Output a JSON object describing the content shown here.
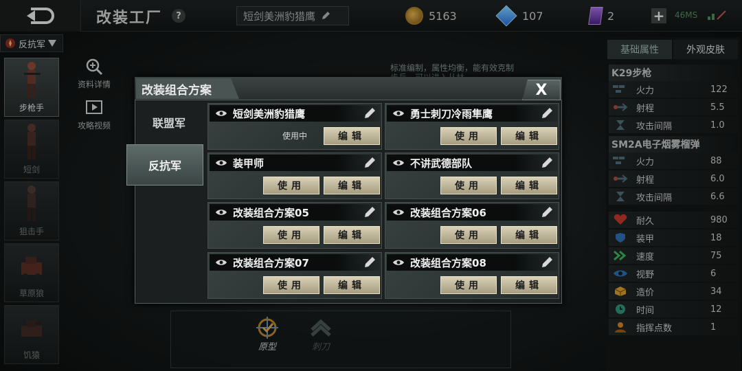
{
  "topbar": {
    "title": "改装工厂",
    "help": "?",
    "loadout_name": "短剑美洲豹猎鹰",
    "gold": "5163",
    "diamonds": "107",
    "cards": "2",
    "ping": "46MS"
  },
  "left": {
    "faction": "反抗军",
    "units": [
      "步枪手",
      "短剑",
      "狙击手",
      "草原狼",
      "饥猿"
    ],
    "tools": [
      "资料详情",
      "攻略视频"
    ]
  },
  "background_note": "标准编制，属性均衡，能有效克制步兵，可以进入丛林",
  "bottom": {
    "prototype": "原型",
    "dagger": "刺刀"
  },
  "right": {
    "tabs": [
      "基础属性",
      "外观皮肤"
    ],
    "weapon1": {
      "name": "K29步枪",
      "stats": [
        {
          "label": "火力",
          "value": "122"
        },
        {
          "label": "射程",
          "value": "5.5"
        },
        {
          "label": "攻击间隔",
          "value": "1.0"
        }
      ]
    },
    "weapon2": {
      "name": "SM2A电子烟雾榴弹",
      "stats": [
        {
          "label": "火力",
          "value": "88"
        },
        {
          "label": "射程",
          "value": "6.0"
        },
        {
          "label": "攻击间隔",
          "value": "6.6"
        }
      ]
    },
    "attrs": [
      {
        "label": "耐久",
        "value": "980"
      },
      {
        "label": "装甲",
        "value": "18"
      },
      {
        "label": "速度",
        "value": "75"
      },
      {
        "label": "视野",
        "value": "6"
      },
      {
        "label": "造价",
        "value": "34"
      },
      {
        "label": "时间",
        "value": "12"
      },
      {
        "label": "指挥点数",
        "value": "1"
      }
    ]
  },
  "modal": {
    "title": "改装组合方案",
    "close": "X",
    "faction_tabs": [
      "联盟军",
      "反抗军"
    ],
    "use_label": "使用",
    "edit_label": "编辑",
    "in_use_label": "使用中",
    "plans": [
      {
        "name": "短剑美洲豹猎鹰"
      },
      {
        "name": "勇士刺刀冷雨隼鹰"
      },
      {
        "name": "装甲师"
      },
      {
        "name": "不讲武德部队"
      },
      {
        "name": "改装组合方案05"
      },
      {
        "name": "改装组合方案06"
      },
      {
        "name": "改装组合方案07"
      },
      {
        "name": "改装组合方案08"
      }
    ]
  }
}
